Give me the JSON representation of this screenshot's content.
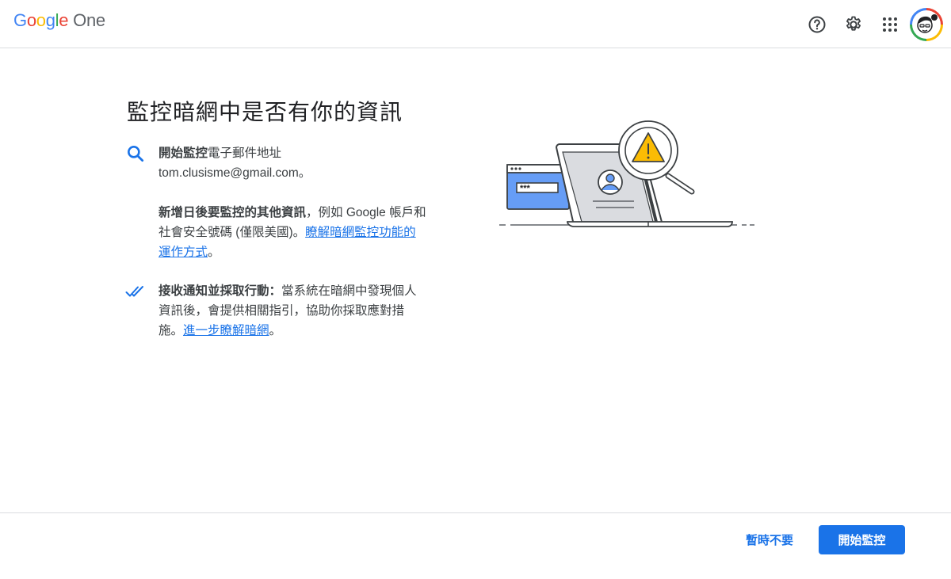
{
  "header": {
    "logo": {
      "g1": "G",
      "o1": "o",
      "o2": "o",
      "g2": "g",
      "l": "l",
      "e": "e",
      "product": "One"
    },
    "icons": [
      "help-icon",
      "settings-gear-icon",
      "apps-grid-icon"
    ],
    "avatar_icon": "user-avatar"
  },
  "main": {
    "title": "監控暗網中是否有你的資訊",
    "features": [
      {
        "icon": "search-icon",
        "bold1": "開始監控",
        "text1": "電子郵件地址",
        "email": "tom.clusisme@gmail.com",
        "text1_end": "。",
        "bold2": "新增日後要監控的其他資訊",
        "text2": "，例如 Google 帳戶和社會安全號碼 (僅限美國)。",
        "link": "瞭解暗網監控功能的運作方式",
        "text2_end": "。"
      },
      {
        "icon": "double-check-icon",
        "bold": "接收通知並採取行動：",
        "text": "當系統在暗網中發現個人資訊後，會提供相關指引，協助你採取應對措施。",
        "link": "進一步瞭解暗網",
        "text_end": "。"
      }
    ],
    "illustration": {
      "password_mask": "***",
      "icon": "laptop-warning-magnifier-illustration"
    }
  },
  "footer": {
    "secondary_label": "暫時不要",
    "primary_label": "開始監控"
  },
  "colors": {
    "accent": "#1a73e8",
    "warning": "#fbbc04",
    "divider": "#dadce0"
  }
}
